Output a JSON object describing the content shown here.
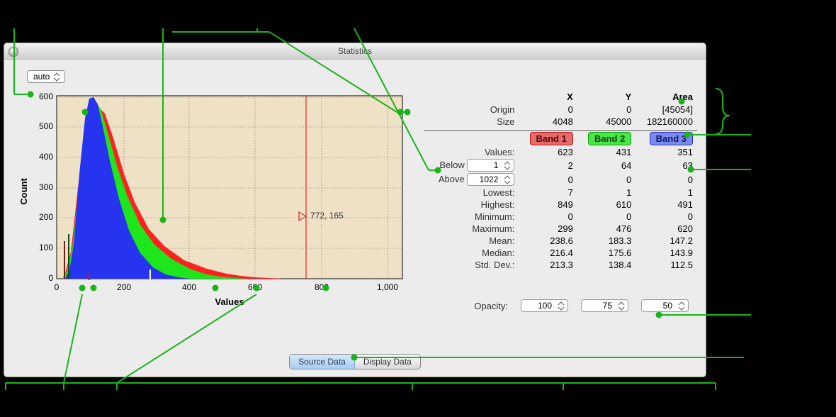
{
  "window": {
    "title": "Statistics"
  },
  "chart": {
    "bin_mode": "auto",
    "xlabel": "Values",
    "ylabel": "Count",
    "cursor_label": "772, 165"
  },
  "chart_data": {
    "type": "bar",
    "title": "",
    "xlabel": "Values",
    "ylabel": "Count",
    "xlim": [
      0,
      1000
    ],
    "ylim": [
      0,
      600
    ],
    "x_ticks": [
      0,
      200,
      400,
      600,
      800,
      1000
    ],
    "y_ticks": [
      0,
      100,
      200,
      300,
      400,
      500,
      600
    ],
    "cursor": {
      "x": 772,
      "y": 165
    },
    "series": [
      {
        "name": "Band 1",
        "color": "#ff2020",
        "x": [
          0,
          20,
          45,
          75,
          100,
          125,
          150,
          180,
          220,
          260,
          300,
          340,
          400,
          500,
          600,
          700,
          800,
          900,
          1000
        ],
        "values": [
          0,
          20,
          90,
          300,
          560,
          600,
          560,
          460,
          310,
          200,
          140,
          95,
          55,
          22,
          10,
          4,
          1,
          0,
          0
        ]
      },
      {
        "name": "Band 2",
        "color": "#1de61d",
        "x": [
          0,
          20,
          45,
          75,
          100,
          125,
          150,
          180,
          220,
          260,
          300,
          340,
          400,
          500,
          600
        ],
        "values": [
          0,
          25,
          100,
          330,
          600,
          620,
          560,
          440,
          290,
          180,
          110,
          70,
          30,
          8,
          0
        ]
      },
      {
        "name": "Band 3",
        "color": "#2634ef",
        "x": [
          0,
          20,
          40,
          60,
          85,
          105,
          125,
          150,
          180,
          210,
          250,
          300,
          350,
          400
        ],
        "values": [
          0,
          30,
          110,
          360,
          620,
          630,
          580,
          440,
          280,
          160,
          80,
          30,
          10,
          0
        ]
      }
    ]
  },
  "stats": {
    "cols": [
      "X",
      "Y",
      "Area"
    ],
    "origin": {
      "label": "Origin",
      "x": "0",
      "y": "0",
      "area": "[45054]"
    },
    "size": {
      "label": "Size",
      "x": "4048",
      "y": "45000",
      "area": "182160000"
    },
    "bands": [
      "Band 1",
      "Band 2",
      "Band 3"
    ],
    "rows": {
      "values": {
        "label": "Values:",
        "v": [
          "623",
          "431",
          "351"
        ]
      },
      "below": {
        "label": "Below",
        "threshold": "1",
        "v": [
          "2",
          "64",
          "63"
        ]
      },
      "above": {
        "label": "Above",
        "threshold": "1022",
        "v": [
          "0",
          "0",
          "0"
        ]
      },
      "lowest": {
        "label": "Lowest:",
        "v": [
          "7",
          "1",
          "1"
        ]
      },
      "highest": {
        "label": "Highest:",
        "v": [
          "849",
          "610",
          "491"
        ]
      },
      "minimum": {
        "label": "Minimum:",
        "v": [
          "0",
          "0",
          "0"
        ]
      },
      "maximum": {
        "label": "Maximum:",
        "v": [
          "299",
          "476",
          "620"
        ]
      },
      "mean": {
        "label": "Mean:",
        "v": [
          "238.6",
          "183.3",
          "147.2"
        ]
      },
      "median": {
        "label": "Median:",
        "v": [
          "216.4",
          "175.6",
          "143.9"
        ]
      },
      "stddev": {
        "label": "Std. Dev.:",
        "v": [
          "213.3",
          "138.4",
          "112.5"
        ]
      }
    }
  },
  "opacity": {
    "label": "Opacity:",
    "values": [
      "100",
      "75",
      "50"
    ]
  },
  "tabs": [
    "Source Data",
    "Display Data"
  ]
}
